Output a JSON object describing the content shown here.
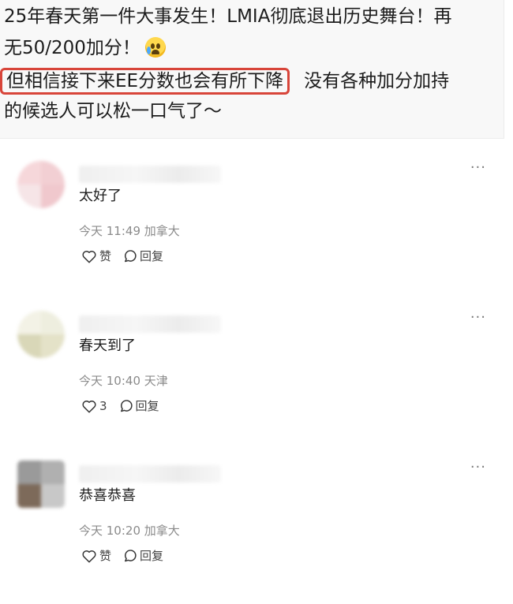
{
  "post": {
    "line1": "25年春天第一件大事发生！LMIA彻底退出历史舞台！再",
    "line2": "无50/200加分！",
    "line3_highlight": "但相信接下来EE分数也会有所下降",
    "line3_rest": "没有各种加分加持",
    "line4": "的候选人可以松一口气了～",
    "emoji": "crying-face-icon"
  },
  "comments": [
    {
      "text": "太好了",
      "time": "今天 11:49",
      "location": "加拿大",
      "like_label": "赞",
      "reply_label": "回复",
      "avatar_colors": [
        "#f6d7da",
        "#f2cfd3",
        "#f6e5e7",
        "#f0c8cd"
      ]
    },
    {
      "text": "春天到了",
      "time": "今天 10:40",
      "location": "天津",
      "like_label": "3",
      "reply_label": "回复",
      "avatar_colors": [
        "#f3f2e6",
        "#eeeedf",
        "#d9d7b8",
        "#e4e2c8"
      ]
    },
    {
      "text": "恭喜恭喜",
      "time": "今天 10:20",
      "location": "加拿大",
      "like_label": "赞",
      "reply_label": "回复",
      "avatar_colors": [
        "#9a9a9a",
        "#b0b0b0",
        "#7d6a5a",
        "#c8c8c8"
      ]
    }
  ],
  "icons": {
    "like": "heart-outline-icon",
    "reply": "speech-bubble-icon",
    "more": "more-dots-icon"
  },
  "colors": {
    "highlight_border": "#d8453a",
    "meta_text": "#8b8b8b"
  }
}
